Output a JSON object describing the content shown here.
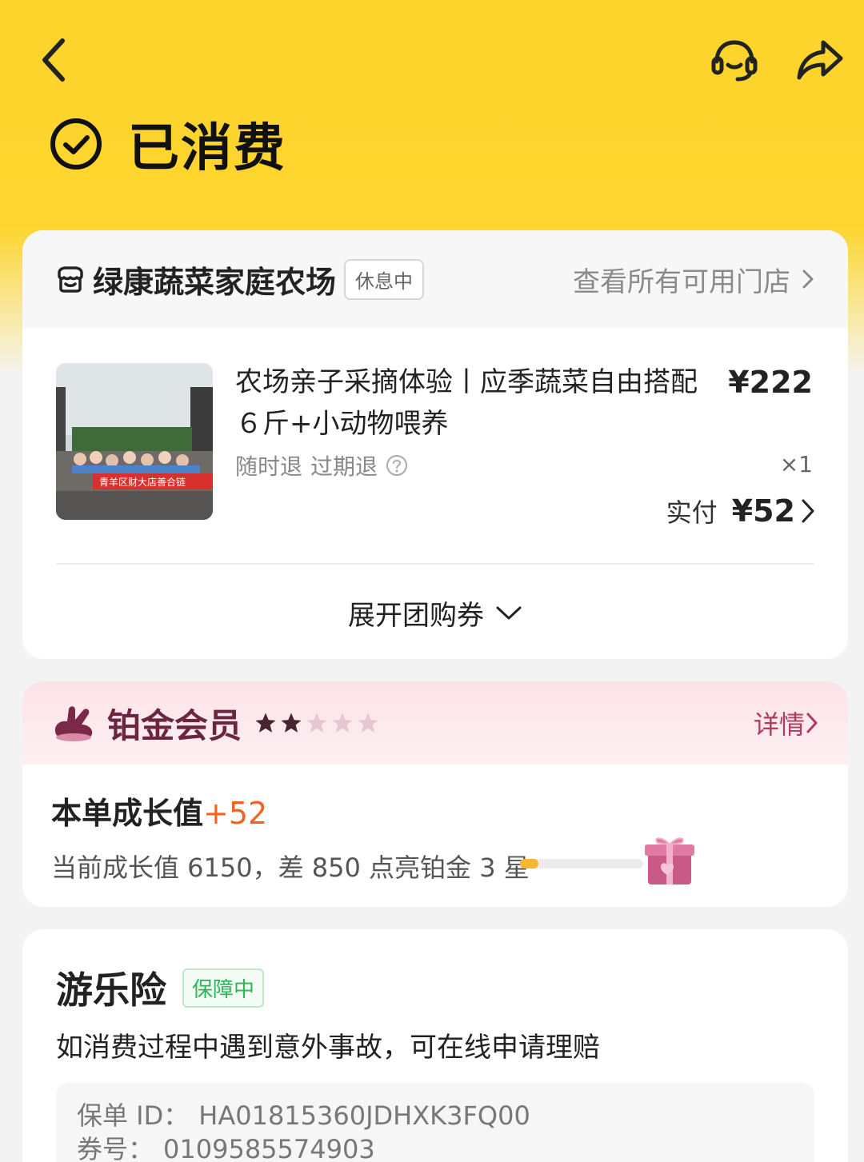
{
  "header": {
    "status_text": "已消费"
  },
  "store": {
    "name": "绿康蔬菜家庭农场",
    "badge": "休息中",
    "link_label": "查看所有可用门店"
  },
  "product": {
    "title": "农场亲子采摘体验丨应季蔬菜自由搭配６斤+小动物喂养",
    "price": "¥222",
    "tags": [
      "随时退",
      "过期退"
    ],
    "quantity": "×1",
    "paid_label": "实付",
    "paid_amount": "¥52",
    "thumb_banner_text": "青羊区财大店善合链"
  },
  "expand_label": "展开团购券",
  "member": {
    "tier": "铂金会员",
    "stars_filled": 2,
    "stars_total": 5,
    "detail_label": "详情",
    "growth_label": "本单成长值",
    "growth_value": "+52",
    "progress_text": "当前成长值 6150，差 850 点亮铂金 3 星",
    "progress_fraction": 0.15
  },
  "insurance": {
    "title": "游乐险",
    "badge": "保障中",
    "description": "如消费过程中遇到意外事故，可在线申请理赔",
    "policy_label": "保单 ID：",
    "policy_id": "HA01815360JDHXK3FQ00",
    "coupon_label": "券号：",
    "coupon_no": "0109585574903"
  },
  "colors": {
    "hero_yellow": "#fdd42b",
    "accent_orange": "#f06524",
    "member_pink": "#b03a60",
    "insured_green": "#2db45a"
  }
}
